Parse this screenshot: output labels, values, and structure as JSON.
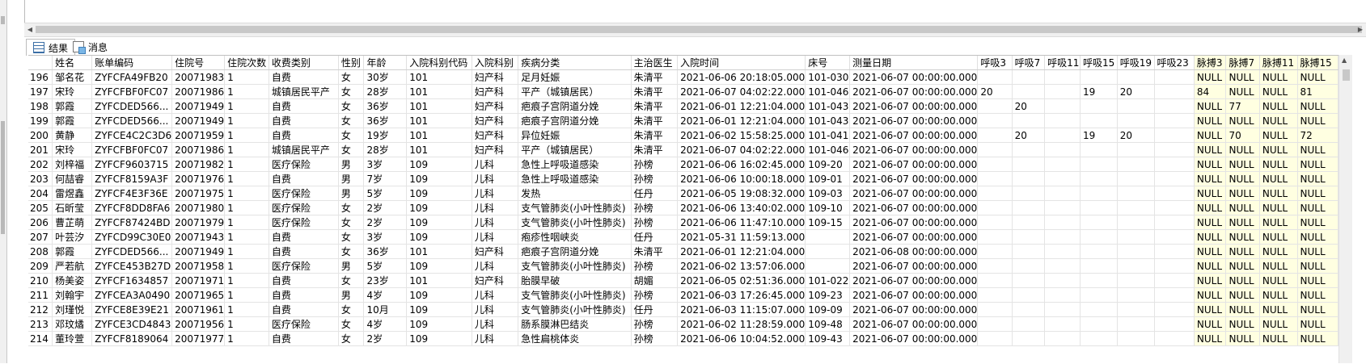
{
  "tabs": {
    "results_label": "结果",
    "messages_label": "消息"
  },
  "table": {
    "columns": [
      "",
      "姓名",
      "账单编码",
      "住院号",
      "住院次数",
      "收费类别",
      "性别",
      "年龄",
      "入院科别代码",
      "入院科别",
      "疾病分类",
      "主治医生",
      "入院时间",
      "床号",
      "测量日期",
      "呼吸3",
      "呼吸7",
      "呼吸11",
      "呼吸15",
      "呼吸19",
      "呼吸23",
      "脉搏3",
      "脉搏7",
      "脉搏11",
      "脉搏15"
    ],
    "rows": [
      [
        "196",
        "邹名花",
        "ZYFCFA49FB20",
        "20071983",
        "1",
        "自费",
        "女",
        "30岁",
        "101",
        "妇产科",
        "足月妊娠",
        "朱清平",
        "2021-06-06 20:18:05.000",
        "101-030",
        "2021-06-07 00:00:00.000",
        "",
        "",
        "",
        "",
        "",
        "",
        "NULL",
        "NULL",
        "NULL",
        "NULL"
      ],
      [
        "197",
        "宋玲",
        "ZYFCFBF0FC07",
        "20071986",
        "1",
        "城镇居民平产",
        "女",
        "28岁",
        "101",
        "妇产科",
        "平产（城镇居民）",
        "朱清平",
        "2021-06-07 04:02:22.000",
        "101-046",
        "2021-06-07 00:00:00.000",
        "20",
        "",
        "",
        "19",
        "20",
        "",
        "84",
        "NULL",
        "NULL",
        "81"
      ],
      [
        "198",
        "郭霞",
        "ZYFCDED566...",
        "20071949",
        "1",
        "自费",
        "女",
        "36岁",
        "101",
        "妇产科",
        "疤痕子宫阴道分娩",
        "朱清平",
        "2021-06-01 12:21:04.000",
        "101-043",
        "2021-06-07 00:00:00.000",
        "",
        "20",
        "",
        "",
        "",
        "",
        "NULL",
        "77",
        "NULL",
        "NULL"
      ],
      [
        "199",
        "郭霞",
        "ZYFCDED566...",
        "20071949",
        "1",
        "自费",
        "女",
        "36岁",
        "101",
        "妇产科",
        "疤痕子宫阴道分娩",
        "朱清平",
        "2021-06-01 12:21:04.000",
        "101-043",
        "2021-06-07 00:00:00.000",
        "",
        "",
        "",
        "",
        "",
        "",
        "NULL",
        "NULL",
        "NULL",
        "NULL"
      ],
      [
        "200",
        "黄静",
        "ZYFCE4C2C3D6",
        "20071959",
        "1",
        "自费",
        "女",
        "19岁",
        "101",
        "妇产科",
        "异位妊娠",
        "朱清平",
        "2021-06-02 15:58:25.000",
        "101-041",
        "2021-06-07 00:00:00.000",
        "",
        "20",
        "",
        "19",
        "20",
        "",
        "NULL",
        "70",
        "NULL",
        "72"
      ],
      [
        "201",
        "宋玲",
        "ZYFCFBF0FC07",
        "20071986",
        "1",
        "城镇居民平产",
        "女",
        "28岁",
        "101",
        "妇产科",
        "平产（城镇居民）",
        "朱清平",
        "2021-06-07 04:02:22.000",
        "101-046",
        "2021-06-07 00:00:00.000",
        "",
        "",
        "",
        "",
        "",
        "",
        "NULL",
        "NULL",
        "NULL",
        "NULL"
      ],
      [
        "202",
        "刘梓福",
        "ZYFCF9603715",
        "20071982",
        "1",
        "医疗保险",
        "男",
        "3岁",
        "109",
        "儿科",
        "急性上呼吸道感染",
        "孙榜",
        "2021-06-06 16:02:45.000",
        "109-20",
        "2021-06-07 00:00:00.000",
        "",
        "",
        "",
        "",
        "",
        "",
        "NULL",
        "NULL",
        "NULL",
        "NULL"
      ],
      [
        "203",
        "何喆睿",
        "ZYFCF8159A3F",
        "20071976",
        "1",
        "自费",
        "男",
        "7岁",
        "109",
        "儿科",
        "急性上呼吸道感染",
        "孙榜",
        "2021-06-06 10:00:18.000",
        "109-01",
        "2021-06-07 00:00:00.000",
        "",
        "",
        "",
        "",
        "",
        "",
        "NULL",
        "NULL",
        "NULL",
        "NULL"
      ],
      [
        "204",
        "雷煜鑫",
        "ZYFCF4E3F36E",
        "20071975",
        "1",
        "医疗保险",
        "男",
        "5岁",
        "109",
        "儿科",
        "发热",
        "任丹",
        "2021-06-05 19:08:32.000",
        "109-03",
        "2021-06-07 00:00:00.000",
        "",
        "",
        "",
        "",
        "",
        "",
        "NULL",
        "NULL",
        "NULL",
        "NULL"
      ],
      [
        "205",
        "石昕莹",
        "ZYFCF8DD8FA6",
        "20071980",
        "1",
        "医疗保险",
        "女",
        "2岁",
        "109",
        "儿科",
        "支气管肺炎(小叶性肺炎)",
        "孙榜",
        "2021-06-06 13:40:02.000",
        "109-10",
        "2021-06-07 00:00:00.000",
        "",
        "",
        "",
        "",
        "",
        "",
        "NULL",
        "NULL",
        "NULL",
        "NULL"
      ],
      [
        "206",
        "曹芷萌",
        "ZYFCF87424BD",
        "20071979",
        "1",
        "医疗保险",
        "女",
        "2岁",
        "109",
        "儿科",
        "支气管肺炎(小叶性肺炎)",
        "孙榜",
        "2021-06-06 11:47:10.000",
        "109-15",
        "2021-06-07 00:00:00.000",
        "",
        "",
        "",
        "",
        "",
        "",
        "NULL",
        "NULL",
        "NULL",
        "NULL"
      ],
      [
        "207",
        "叶芸汐",
        "ZYFCD99C30E0",
        "20071943",
        "1",
        "自费",
        "女",
        "3岁",
        "109",
        "儿科",
        "疱疹性咽峡炎",
        "任丹",
        "2021-05-31 11:59:13.000",
        "",
        "2021-06-07 00:00:00.000",
        "",
        "",
        "",
        "",
        "",
        "",
        "NULL",
        "NULL",
        "NULL",
        "NULL"
      ],
      [
        "208",
        "郭霞",
        "ZYFCDED566...",
        "20071949",
        "1",
        "自费",
        "女",
        "36岁",
        "101",
        "妇产科",
        "疤痕子宫阴道分娩",
        "朱清平",
        "2021-06-01 12:21:04.000",
        "",
        "2021-06-08 00:00:00.000",
        "",
        "",
        "",
        "",
        "",
        "",
        "NULL",
        "NULL",
        "NULL",
        "NULL"
      ],
      [
        "209",
        "严若航",
        "ZYFCE453B27D",
        "20071958",
        "1",
        "医疗保险",
        "男",
        "5岁",
        "109",
        "儿科",
        "支气管肺炎(小叶性肺炎)",
        "孙榜",
        "2021-06-02 13:57:06.000",
        "",
        "2021-06-07 00:00:00.000",
        "",
        "",
        "",
        "",
        "",
        "",
        "NULL",
        "NULL",
        "NULL",
        "NULL"
      ],
      [
        "210",
        "杨美姿",
        "ZYFCF1634857",
        "20071971",
        "1",
        "自费",
        "女",
        "23岁",
        "101",
        "妇产科",
        "胎膜早破",
        "胡媚",
        "2021-06-05 02:51:36.000",
        "101-022",
        "2021-06-07 00:00:00.000",
        "",
        "",
        "",
        "",
        "",
        "",
        "NULL",
        "NULL",
        "NULL",
        "NULL"
      ],
      [
        "211",
        "刘翰宇",
        "ZYFCEA3A0490",
        "20071965",
        "1",
        "自费",
        "男",
        "4岁",
        "109",
        "儿科",
        "支气管肺炎(小叶性肺炎)",
        "孙榜",
        "2021-06-03 17:26:45.000",
        "109-23",
        "2021-06-07 00:00:00.000",
        "",
        "",
        "",
        "",
        "",
        "",
        "NULL",
        "NULL",
        "NULL",
        "NULL"
      ],
      [
        "212",
        "刘瑾悦",
        "ZYFCE8E39E21",
        "20071961",
        "1",
        "自费",
        "女",
        "10月",
        "109",
        "儿科",
        "支气管肺炎(小叶性肺炎)",
        "任丹",
        "2021-06-03 11:15:07.000",
        "109-09",
        "2021-06-07 00:00:00.000",
        "",
        "",
        "",
        "",
        "",
        "",
        "NULL",
        "NULL",
        "NULL",
        "NULL"
      ],
      [
        "213",
        "邓玟燏",
        "ZYFCE3CD4843",
        "20071956",
        "1",
        "医疗保险",
        "女",
        "4岁",
        "109",
        "儿科",
        "肠系膜淋巴结炎",
        "孙榜",
        "2021-06-02 11:28:59.000",
        "109-48",
        "2021-06-07 00:00:00.000",
        "",
        "",
        "",
        "",
        "",
        "",
        "NULL",
        "NULL",
        "NULL",
        "NULL"
      ],
      [
        "214",
        "董玲萱",
        "ZYFCF8189064",
        "20071977",
        "1",
        "自费",
        "女",
        "2岁",
        "109",
        "儿科",
        "急性扁桃体炎",
        "孙榜",
        "2021-06-06 10:04:52.000",
        "109-43",
        "2021-06-07 00:00:00.000",
        "",
        "",
        "",
        "",
        "",
        "",
        "NULL",
        "NULL",
        "NULL",
        "NULL"
      ]
    ]
  }
}
